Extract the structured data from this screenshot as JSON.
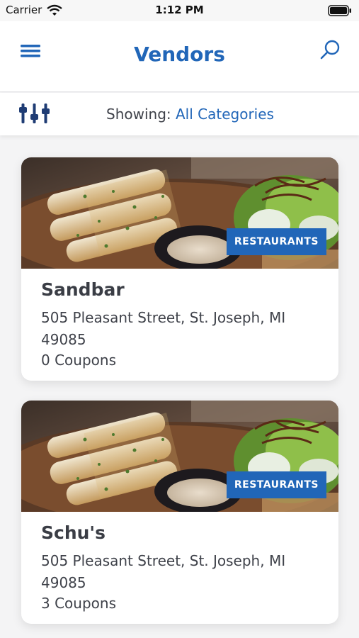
{
  "status_bar": {
    "carrier": "Carrier",
    "time": "1:12 PM"
  },
  "header": {
    "title": "Vendors",
    "menu_icon": "hamburger-menu-icon",
    "search_icon": "search-icon"
  },
  "filter": {
    "icon": "sliders-icon",
    "label": "Showing:",
    "value": "All Categories"
  },
  "colors": {
    "accent": "#2166b8",
    "text": "#3a3d45",
    "background": "#f4f4f5"
  },
  "vendors": [
    {
      "name": "Sandbar",
      "address": "505 Pleasant Street, St. Joseph, MI 49085",
      "coupons": "0 Coupons",
      "category": "RESTAURANTS"
    },
    {
      "name": "Schu's",
      "address": "505 Pleasant Street, St. Joseph, MI 49085",
      "coupons": "3 Coupons",
      "category": "RESTAURANTS"
    }
  ]
}
